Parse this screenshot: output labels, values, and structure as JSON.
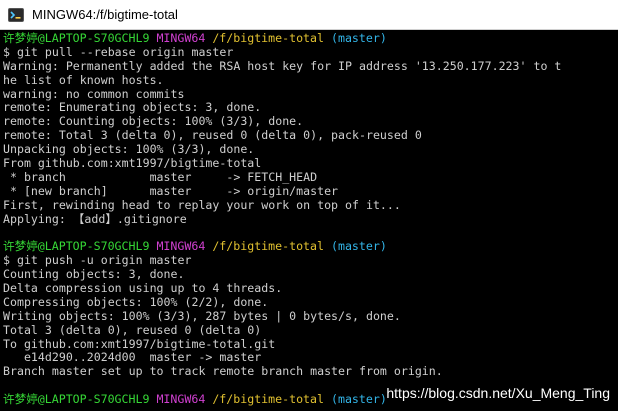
{
  "window": {
    "title": "MINGW64:/f/bigtime-total",
    "icon": "mingw64-terminal-icon"
  },
  "colors": {
    "background": "#000000",
    "text": "#cfcfcf",
    "prompt_user": "#36d836",
    "prompt_msys": "#d040d0",
    "prompt_path": "#e0c030",
    "prompt_branch": "#33b5e8"
  },
  "prompt": {
    "user": "许梦婷@LAPTOP-S70GCHL9",
    "msys": "MINGW64",
    "path": "/f/bigtime-total",
    "branch": "(master)"
  },
  "terminal": {
    "lines": [
      {
        "kind": "prompt"
      },
      {
        "kind": "text",
        "text": "$ git pull --rebase origin master"
      },
      {
        "kind": "text",
        "text": "Warning: Permanently added the RSA host key for IP address '13.250.177.223' to t"
      },
      {
        "kind": "text",
        "text": "he list of known hosts."
      },
      {
        "kind": "text",
        "text": "warning: no common commits"
      },
      {
        "kind": "text",
        "text": "remote: Enumerating objects: 3, done."
      },
      {
        "kind": "text",
        "text": "remote: Counting objects: 100% (3/3), done."
      },
      {
        "kind": "text",
        "text": "remote: Total 3 (delta 0), reused 0 (delta 0), pack-reused 0"
      },
      {
        "kind": "text",
        "text": "Unpacking objects: 100% (3/3), done."
      },
      {
        "kind": "text",
        "text": "From github.com:xmt1997/bigtime-total"
      },
      {
        "kind": "text",
        "text": " * branch            master     -> FETCH_HEAD"
      },
      {
        "kind": "text",
        "text": " * [new branch]      master     -> origin/master"
      },
      {
        "kind": "text",
        "text": "First, rewinding head to replay your work on top of it..."
      },
      {
        "kind": "text",
        "text": "Applying: 【add】.gitignore"
      },
      {
        "kind": "text",
        "text": ""
      },
      {
        "kind": "prompt"
      },
      {
        "kind": "text",
        "text": "$ git push -u origin master"
      },
      {
        "kind": "text",
        "text": "Counting objects: 3, done."
      },
      {
        "kind": "text",
        "text": "Delta compression using up to 4 threads."
      },
      {
        "kind": "text",
        "text": "Compressing objects: 100% (2/2), done."
      },
      {
        "kind": "text",
        "text": "Writing objects: 100% (3/3), 287 bytes | 0 bytes/s, done."
      },
      {
        "kind": "text",
        "text": "Total 3 (delta 0), reused 0 (delta 0)"
      },
      {
        "kind": "text",
        "text": "To github.com:xmt1997/bigtime-total.git"
      },
      {
        "kind": "text",
        "text": "   e14d290..2024d00  master -> master"
      },
      {
        "kind": "text",
        "text": "Branch master set up to track remote branch master from origin."
      },
      {
        "kind": "text",
        "text": ""
      },
      {
        "kind": "prompt"
      }
    ]
  },
  "watermark": "https://blog.csdn.net/Xu_Meng_Ting"
}
